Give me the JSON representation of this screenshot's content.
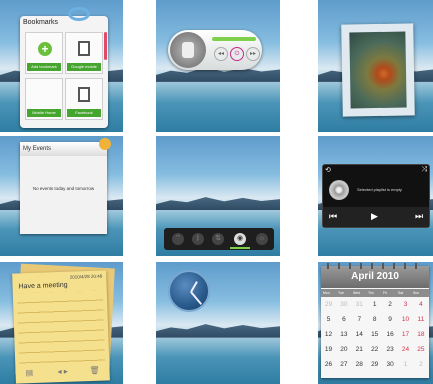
{
  "bookmarks": {
    "title": "Bookmarks",
    "items": [
      {
        "label": "Add bookmark"
      },
      {
        "label": "Google mobile"
      },
      {
        "label": "Mobile Home"
      },
      {
        "label": "Facebook"
      }
    ]
  },
  "events": {
    "title": "My Events",
    "empty_text": "No events today and tomorrow"
  },
  "music_player": {
    "status": "Selected playlist is empty"
  },
  "note": {
    "date": "2010/4/28  20:48",
    "text": "Have a meeting"
  },
  "calendar": {
    "month": "April 2010",
    "weekdays": [
      "Mon",
      "Tue",
      "Wed",
      "Thu",
      "Fri",
      "Sat",
      "Sun"
    ],
    "weeks": [
      [
        "29",
        "30",
        "31",
        "1",
        "2",
        "3",
        "4"
      ],
      [
        "5",
        "6",
        "7",
        "8",
        "9",
        "10",
        "11"
      ],
      [
        "12",
        "13",
        "14",
        "15",
        "16",
        "17",
        "18"
      ],
      [
        "19",
        "20",
        "21",
        "22",
        "23",
        "24",
        "25"
      ],
      [
        "26",
        "27",
        "28",
        "29",
        "30",
        "1",
        "2"
      ]
    ]
  }
}
